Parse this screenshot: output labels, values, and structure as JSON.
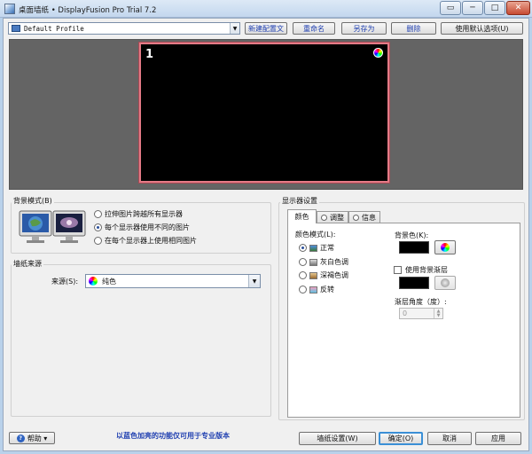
{
  "window": {
    "title": "桌面墙纸 • DisplayFusion Pro Trial 7.2",
    "extra_glyph": "▭",
    "minimize_glyph": "─",
    "maximize_glyph": "□",
    "close_glyph": "✕"
  },
  "profile": {
    "selected": "Default Profile",
    "dropdown_glyph": "▼",
    "buttons": {
      "new": "新建配置文",
      "rename": "重命名",
      "save_as": "另存为",
      "delete": "删除",
      "use_default": "使用默认选项(U)"
    }
  },
  "preview": {
    "monitor_number": "1"
  },
  "background_mode": {
    "group_title": "背景模式(B)",
    "options": [
      {
        "label": "拉伸图片跨越所有显示器",
        "selected": false
      },
      {
        "label": "每个显示器使用不同的图片",
        "selected": true
      },
      {
        "label": "在每个显示器上使用相同图片",
        "selected": false
      }
    ]
  },
  "wallpaper_source": {
    "group_title": "墙纸来源",
    "label": "来源(S):",
    "selected": "纯色",
    "dropdown_glyph": "▼"
  },
  "monitor_settings": {
    "group_title": "显示器设置",
    "tabs": [
      {
        "label": "颜色",
        "active": true
      },
      {
        "label": "调整",
        "active": false
      },
      {
        "label": "信息",
        "active": false
      }
    ],
    "color_mode_label": "颜色模式(L):",
    "color_modes": [
      {
        "label": "正常",
        "selected": true
      },
      {
        "label": "灰白色调",
        "selected": false
      },
      {
        "label": "深褐色调",
        "selected": false
      },
      {
        "label": "反转",
        "selected": false
      }
    ],
    "bg_color_label": "背景色(K):",
    "bg_color": "#000000",
    "use_gradient_label": "使用背景渐层",
    "use_gradient": false,
    "gradient_color": "#000000",
    "gradient_angle_label": "渐层角度（度）:",
    "gradient_angle": "0",
    "spin_up": "▲",
    "spin_down": "▼"
  },
  "footer": {
    "help_icon_glyph": "?",
    "help_label": "帮助 ▾",
    "notice": "以蓝色加亮的功能仅可用于专业版本",
    "wallpaper_settings": "墙纸设置(W)",
    "ok": "确定(O)",
    "cancel": "取消",
    "apply": "应用"
  },
  "colors": {
    "monitor_border": "#e47a86",
    "pro_feature_text": "#1f3fb0",
    "preview_background": "#646464"
  }
}
